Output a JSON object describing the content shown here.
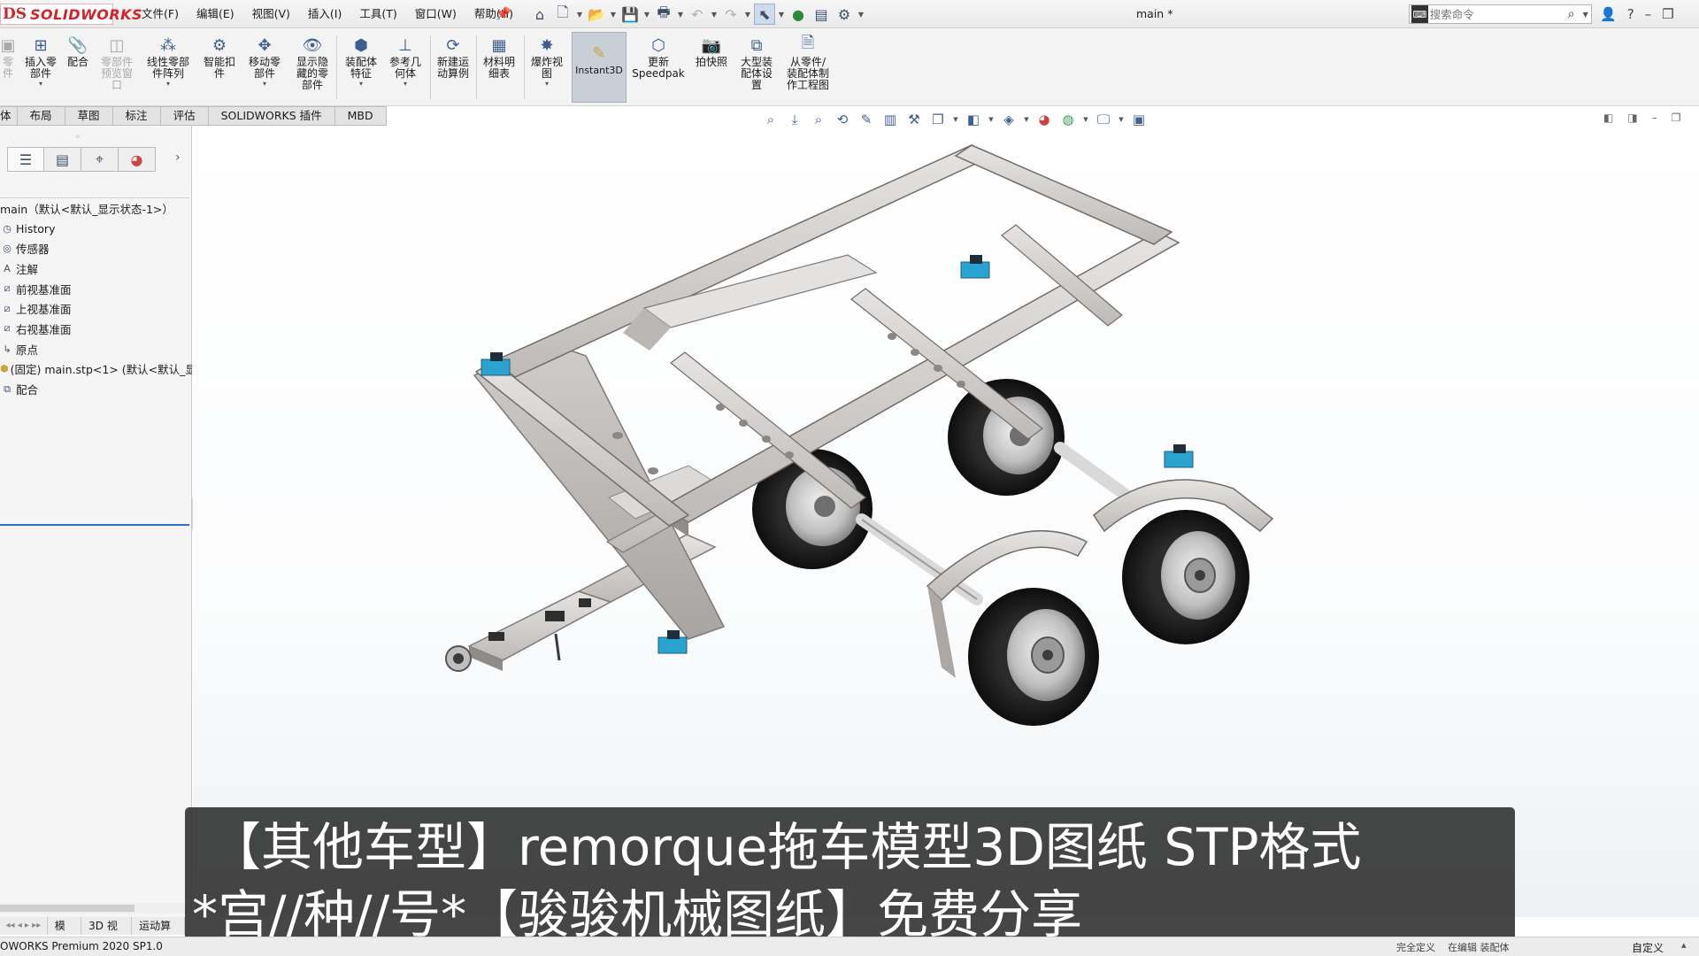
{
  "app": {
    "logo_mark": "DS",
    "logo_text": "SOLIDWORKS",
    "document_title": "main *"
  },
  "menu": [
    "文件(F)",
    "编辑(E)",
    "视图(V)",
    "插入(I)",
    "工具(T)",
    "窗口(W)",
    "帮助(H)"
  ],
  "quick_access_icons": [
    "home-icon",
    "new-document-icon",
    "open-icon",
    "save-icon",
    "print-icon",
    "undo-icon",
    "redo-icon",
    "select-pointer-icon",
    "rebuild-icon",
    "file-properties-icon",
    "options-gear-icon"
  ],
  "search": {
    "placeholder": "搜索命令"
  },
  "command_manager": {
    "items": [
      {
        "label": "零\n件",
        "icon": "part-icon",
        "dim": true
      },
      {
        "label": "插入零\n部件",
        "icon": "insert-component-icon",
        "dropdown": true
      },
      {
        "label": "配合",
        "icon": "mate-icon"
      },
      {
        "label": "零部件\n预览窗\n口",
        "icon": "component-preview-icon",
        "dim": true
      },
      {
        "label": "线性零部\n件阵列",
        "icon": "linear-pattern-icon",
        "dropdown": true
      },
      {
        "label": "智能扣\n件",
        "icon": "smart-fastener-icon"
      },
      {
        "label": "移动零\n部件",
        "icon": "move-component-icon",
        "dropdown": true
      },
      {
        "label": "显示隐\n藏的零\n部件",
        "icon": "show-hidden-icon"
      },
      {
        "label": "装配体\n特征",
        "icon": "assembly-feature-icon",
        "dropdown": true
      },
      {
        "label": "参考几\n何体",
        "icon": "reference-geometry-icon",
        "dropdown": true
      },
      {
        "label": "新建运\n动算例",
        "icon": "motion-study-icon"
      },
      {
        "label": "材料明\n细表",
        "icon": "bill-of-materials-icon"
      },
      {
        "label": "爆炸视\n图",
        "icon": "exploded-view-icon",
        "dropdown": true
      },
      {
        "label": "Instant3D",
        "icon": "instant3d-icon",
        "active": true
      },
      {
        "label": "更新\nSpeedpak",
        "icon": "speedpak-icon"
      },
      {
        "label": "拍快照",
        "icon": "snapshot-icon"
      },
      {
        "label": "大型装\n配体设\n置",
        "icon": "large-assembly-icon"
      },
      {
        "label": "从零件/\n装配体制\n作工程图",
        "icon": "make-drawing-icon"
      }
    ]
  },
  "tabs": [
    "体",
    "布局",
    "草图",
    "标注",
    "评估",
    "SOLIDWORKS 插件",
    "MBD"
  ],
  "view_toolbar_icons": [
    "zoom-to-fit-icon",
    "zoom-area-icon",
    "previous-view-icon",
    "section-view-icon",
    "dynamic-annotation-icon",
    "view-orientation-icon",
    "display-style-icon",
    "hide-show-icon",
    "edit-appearance-icon",
    "apply-scene-icon",
    "view-settings-icon",
    "display-pane-icon"
  ],
  "feature_manager": {
    "panel_tabs": [
      "featuremanager-tree-icon",
      "propertymanager-icon",
      "configurationmanager-icon",
      "display-manager-icon"
    ],
    "tree": [
      {
        "label": "main（默认<默认_显示状态-1>）",
        "icon": "assembly-icon",
        "root": true
      },
      {
        "label": "History",
        "icon": "history-icon"
      },
      {
        "label": "传感器",
        "icon": "sensor-icon"
      },
      {
        "label": "注解",
        "icon": "annotation-icon"
      },
      {
        "label": "前视基准面",
        "icon": "plane-icon"
      },
      {
        "label": "上视基准面",
        "icon": "plane-icon"
      },
      {
        "label": "右视基准面",
        "icon": "plane-icon"
      },
      {
        "label": "原点",
        "icon": "origin-icon"
      },
      {
        "label": "(固定) main.stp<1> (默认<默认_显",
        "icon": "component-icon"
      },
      {
        "label": "配合",
        "icon": "mates-folder-icon"
      }
    ]
  },
  "caption": {
    "line1": "【其他车型】remorque拖车模型3D图纸 STP格式",
    "line2": "*宫//种//号*【骏骏机械图纸】免费分享"
  },
  "bottom_tabs": [
    "模型",
    "3D 视图",
    "运动算例"
  ],
  "status": {
    "product": "OWORKS Premium 2020 SP1.0",
    "right_items": [
      "完全定义",
      "在编辑 装配体"
    ],
    "custom": "自定义"
  },
  "colors": {
    "accent_blue": "#2f6fc6",
    "brand_red": "#d2232a",
    "frame_gray": "#c9c6c3",
    "mount_cyan": "#2aa3d1",
    "caption_bg": "#282828"
  }
}
